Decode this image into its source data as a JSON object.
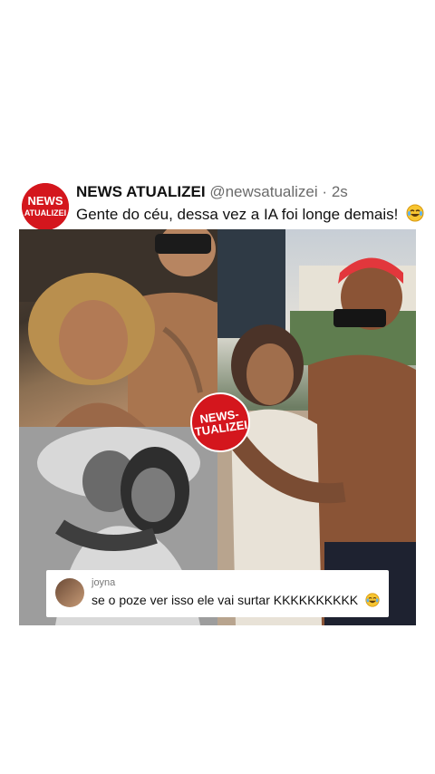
{
  "post": {
    "avatar_text": [
      "NEWS",
      "ATUALIZEI"
    ],
    "name": "NEWS ATUALIZEI",
    "handle": "@newsatualizei",
    "separator": "·",
    "time": "2s",
    "text": "Gente do céu, dessa vez a IA foi longe demais!",
    "text_emoji": "laughing-tears-emoji"
  },
  "collage": {
    "badge_lines": [
      "NEWS-",
      "TUALIZEI"
    ],
    "comment": {
      "user": "joyna",
      "text": "se o poze ver isso ele vai surtar KKKKKKKKKK",
      "emoji": "laughing-tears-emoji"
    }
  },
  "colors": {
    "brand_red": "#d4161d",
    "text": "#111111",
    "muted": "#6b6b6b"
  }
}
